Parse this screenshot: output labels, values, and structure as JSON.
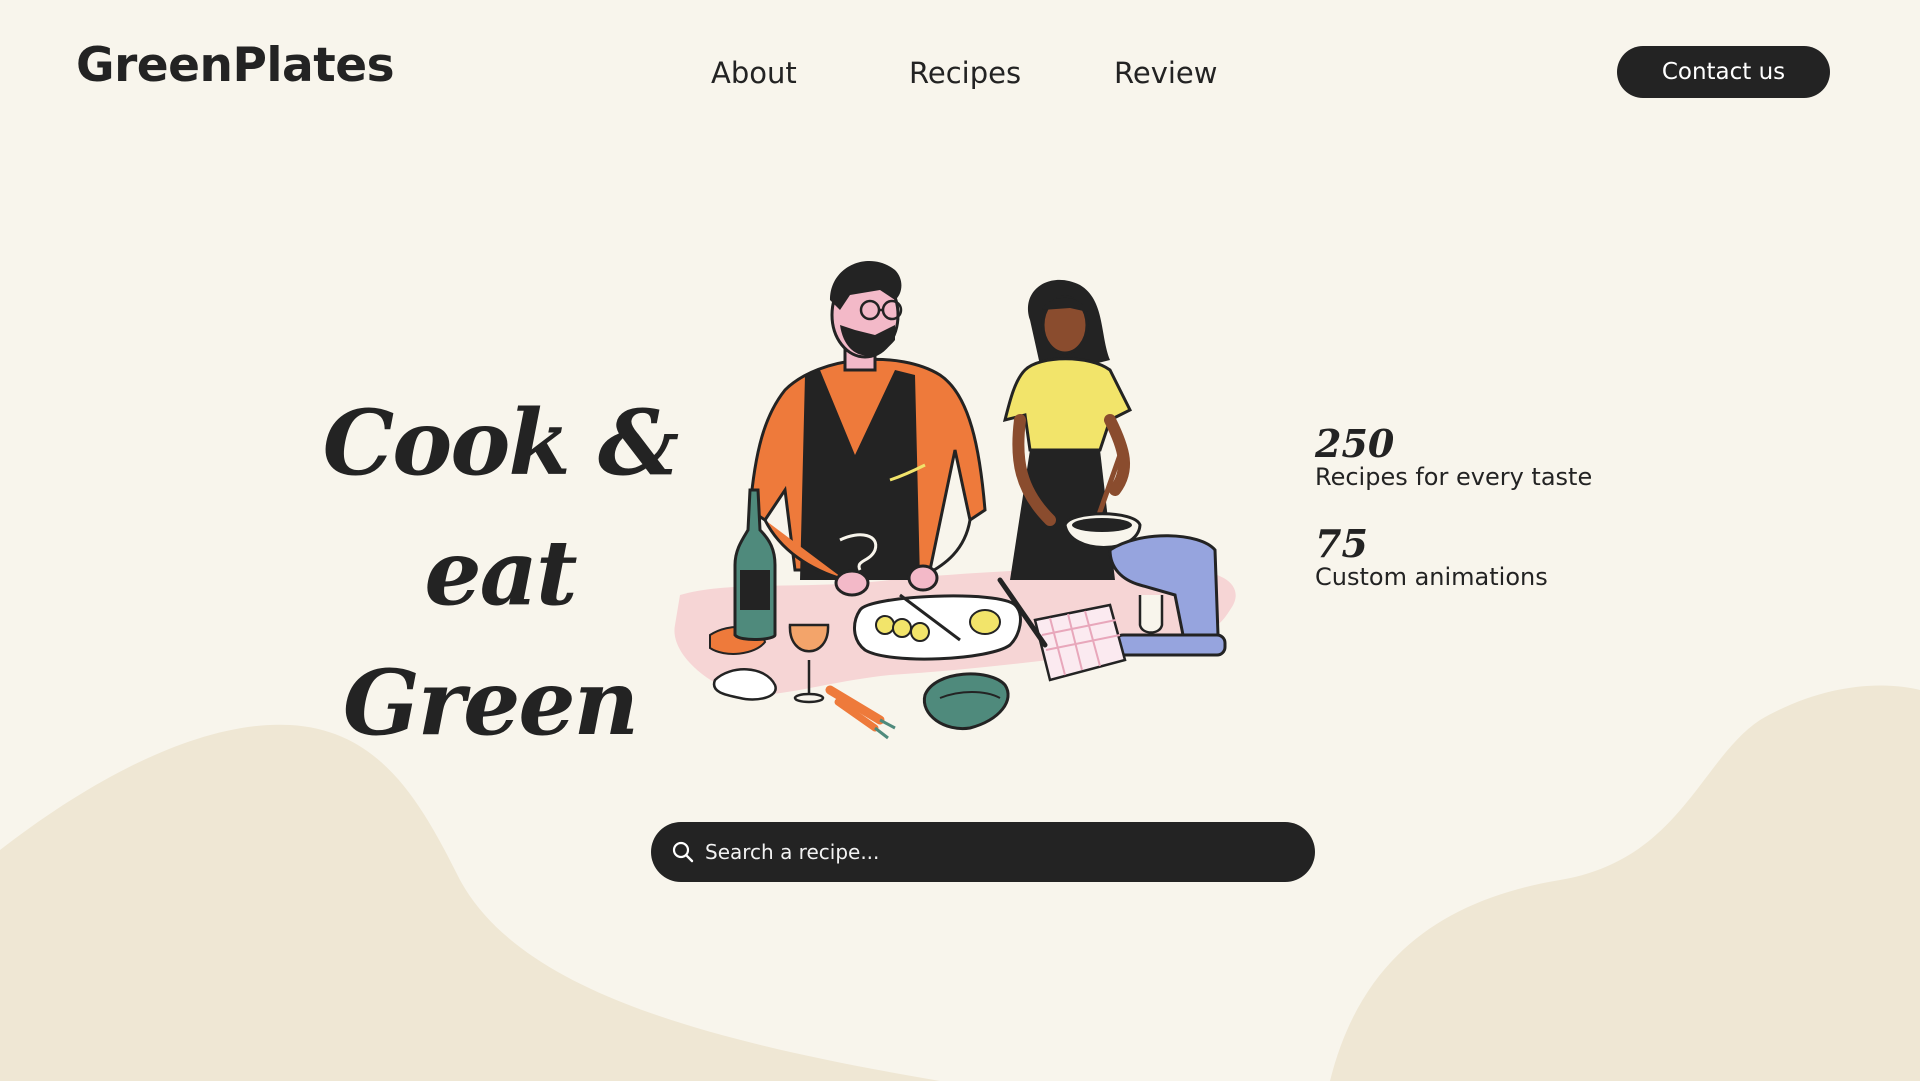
{
  "header": {
    "brand": "GreenPlates",
    "nav": [
      {
        "label": "About"
      },
      {
        "label": "Recipes"
      },
      {
        "label": "Review"
      }
    ],
    "contact_label": "Contact us"
  },
  "hero": {
    "headline_line1": "Cook & eat",
    "headline_line2": "Green",
    "illustration": "couple-cooking-illustration"
  },
  "stats": [
    {
      "number": "250",
      "label": "Recipes for every taste"
    },
    {
      "number": "75",
      "label": "Custom animations"
    }
  ],
  "search": {
    "placeholder": "Search a recipe...",
    "icon": "search-icon"
  },
  "colors": {
    "background": "#f8f5ec",
    "wave": "#efe7d4",
    "dark": "#232323"
  }
}
